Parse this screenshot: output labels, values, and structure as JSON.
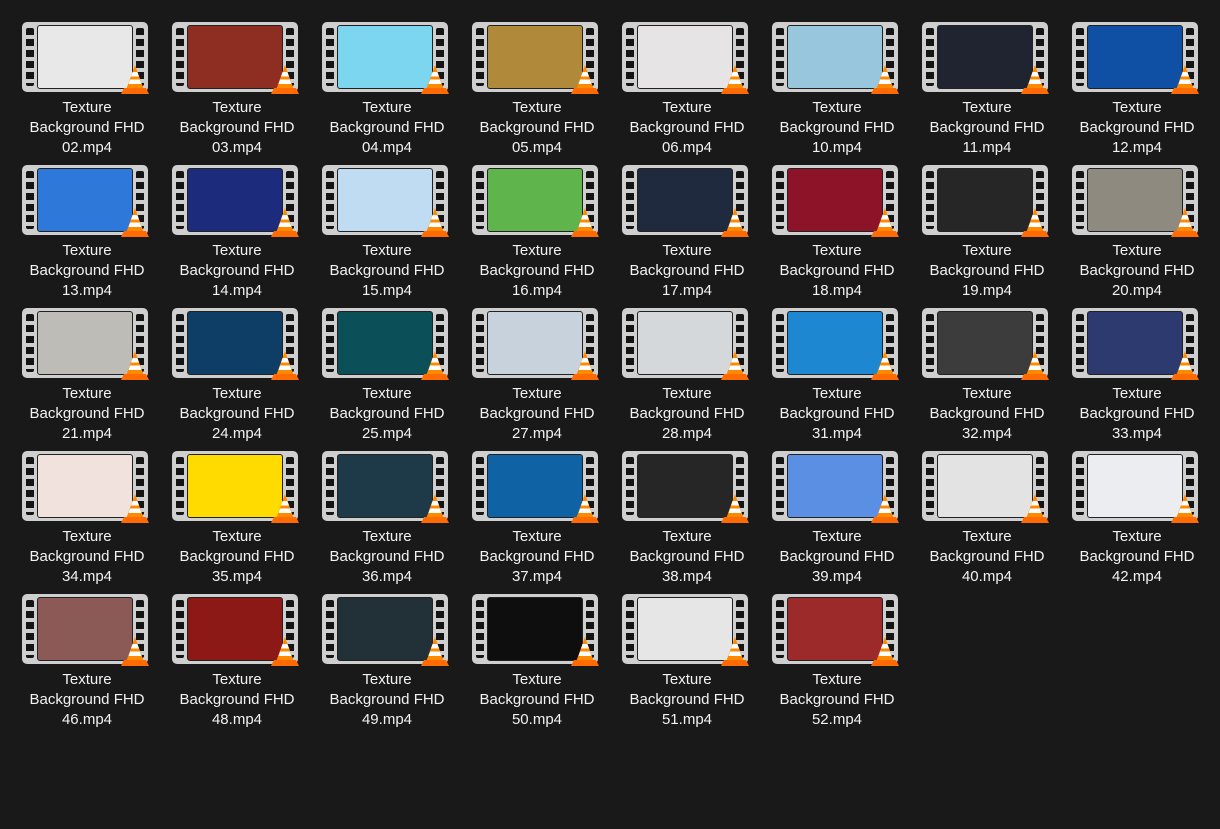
{
  "files": [
    {
      "line1": "Texture",
      "line2": "Background FHD",
      "line3": "02.mp4",
      "bg": "#e8e8e8"
    },
    {
      "line1": "Texture",
      "line2": "Background FHD",
      "line3": "03.mp4",
      "bg": "#8e2d22"
    },
    {
      "line1": "Texture",
      "line2": "Background FHD",
      "line3": "04.mp4",
      "bg": "#7dd6ef"
    },
    {
      "line1": "Texture",
      "line2": "Background FHD",
      "line3": "05.mp4",
      "bg": "#b08a3a"
    },
    {
      "line1": "Texture",
      "line2": "Background FHD",
      "line3": "06.mp4",
      "bg": "#e7e4e6"
    },
    {
      "line1": "Texture",
      "line2": "Background FHD",
      "line3": "10.mp4",
      "bg": "#98c7dd"
    },
    {
      "line1": "Texture",
      "line2": "Background FHD",
      "line3": "11.mp4",
      "bg": "#1f2430"
    },
    {
      "line1": "Texture",
      "line2": "Background FHD",
      "line3": "12.mp4",
      "bg": "#0f4fa4"
    },
    {
      "line1": "Texture",
      "line2": "Background FHD",
      "line3": "13.mp4",
      "bg": "#2d78d8"
    },
    {
      "line1": "Texture",
      "line2": "Background FHD",
      "line3": "14.mp4",
      "bg": "#1d2b7d"
    },
    {
      "line1": "Texture",
      "line2": "Background FHD",
      "line3": "15.mp4",
      "bg": "#bfdcf2"
    },
    {
      "line1": "Texture",
      "line2": "Background FHD",
      "line3": "16.mp4",
      "bg": "#5fb44c"
    },
    {
      "line1": "Texture",
      "line2": "Background FHD",
      "line3": "17.mp4",
      "bg": "#202a3f"
    },
    {
      "line1": "Texture",
      "line2": "Background FHD",
      "line3": "18.mp4",
      "bg": "#8d1428"
    },
    {
      "line1": "Texture",
      "line2": "Background FHD",
      "line3": "19.mp4",
      "bg": "#262626"
    },
    {
      "line1": "Texture",
      "line2": "Background FHD",
      "line3": "20.mp4",
      "bg": "#8f8a80"
    },
    {
      "line1": "Texture",
      "line2": "Background FHD",
      "line3": "21.mp4",
      "bg": "#bdbcb7"
    },
    {
      "line1": "Texture",
      "line2": "Background FHD",
      "line3": "24.mp4",
      "bg": "#0e3d66"
    },
    {
      "line1": "Texture",
      "line2": "Background FHD",
      "line3": "25.mp4",
      "bg": "#0b4f58"
    },
    {
      "line1": "Texture",
      "line2": "Background FHD",
      "line3": "27.mp4",
      "bg": "#c7d2dc"
    },
    {
      "line1": "Texture",
      "line2": "Background FHD",
      "line3": "28.mp4",
      "bg": "#d5d8db"
    },
    {
      "line1": "Texture",
      "line2": "Background FHD",
      "line3": "31.mp4",
      "bg": "#1d87d1"
    },
    {
      "line1": "Texture",
      "line2": "Background FHD",
      "line3": "32.mp4",
      "bg": "#3c3c3c"
    },
    {
      "line1": "Texture",
      "line2": "Background FHD",
      "line3": "33.mp4",
      "bg": "#2d3a70"
    },
    {
      "line1": "Texture",
      "line2": "Background FHD",
      "line3": "34.mp4",
      "bg": "#f1e2dd"
    },
    {
      "line1": "Texture",
      "line2": "Background FHD",
      "line3": "35.mp4",
      "bg": "#ffdb00"
    },
    {
      "line1": "Texture",
      "line2": "Background FHD",
      "line3": "36.mp4",
      "bg": "#1e3948"
    },
    {
      "line1": "Texture",
      "line2": "Background FHD",
      "line3": "37.mp4",
      "bg": "#0f63a4"
    },
    {
      "line1": "Texture",
      "line2": "Background FHD",
      "line3": "38.mp4",
      "bg": "#262626"
    },
    {
      "line1": "Texture",
      "line2": "Background FHD",
      "line3": "39.mp4",
      "bg": "#5b8fe3"
    },
    {
      "line1": "Texture",
      "line2": "Background FHD",
      "line3": "40.mp4",
      "bg": "#e3e3e3"
    },
    {
      "line1": "Texture",
      "line2": "Background FHD",
      "line3": "42.mp4",
      "bg": "#ebedf1"
    },
    {
      "line1": "Texture",
      "line2": "Background FHD",
      "line3": "46.mp4",
      "bg": "#8b5a57"
    },
    {
      "line1": "Texture",
      "line2": "Background FHD",
      "line3": "48.mp4",
      "bg": "#8d1916"
    },
    {
      "line1": "Texture",
      "line2": "Background FHD",
      "line3": "49.mp4",
      "bg": "#223038"
    },
    {
      "line1": "Texture",
      "line2": "Background FHD",
      "line3": "50.mp4",
      "bg": "#0e0e0e"
    },
    {
      "line1": "Texture",
      "line2": "Background FHD",
      "line3": "51.mp4",
      "bg": "#e6e6e6"
    },
    {
      "line1": "Texture",
      "line2": "Background FHD",
      "line3": "52.mp4",
      "bg": "#9c2a2a"
    }
  ],
  "icons": {
    "film": "film-strip-icon",
    "vlc": "vlc-cone-icon"
  }
}
